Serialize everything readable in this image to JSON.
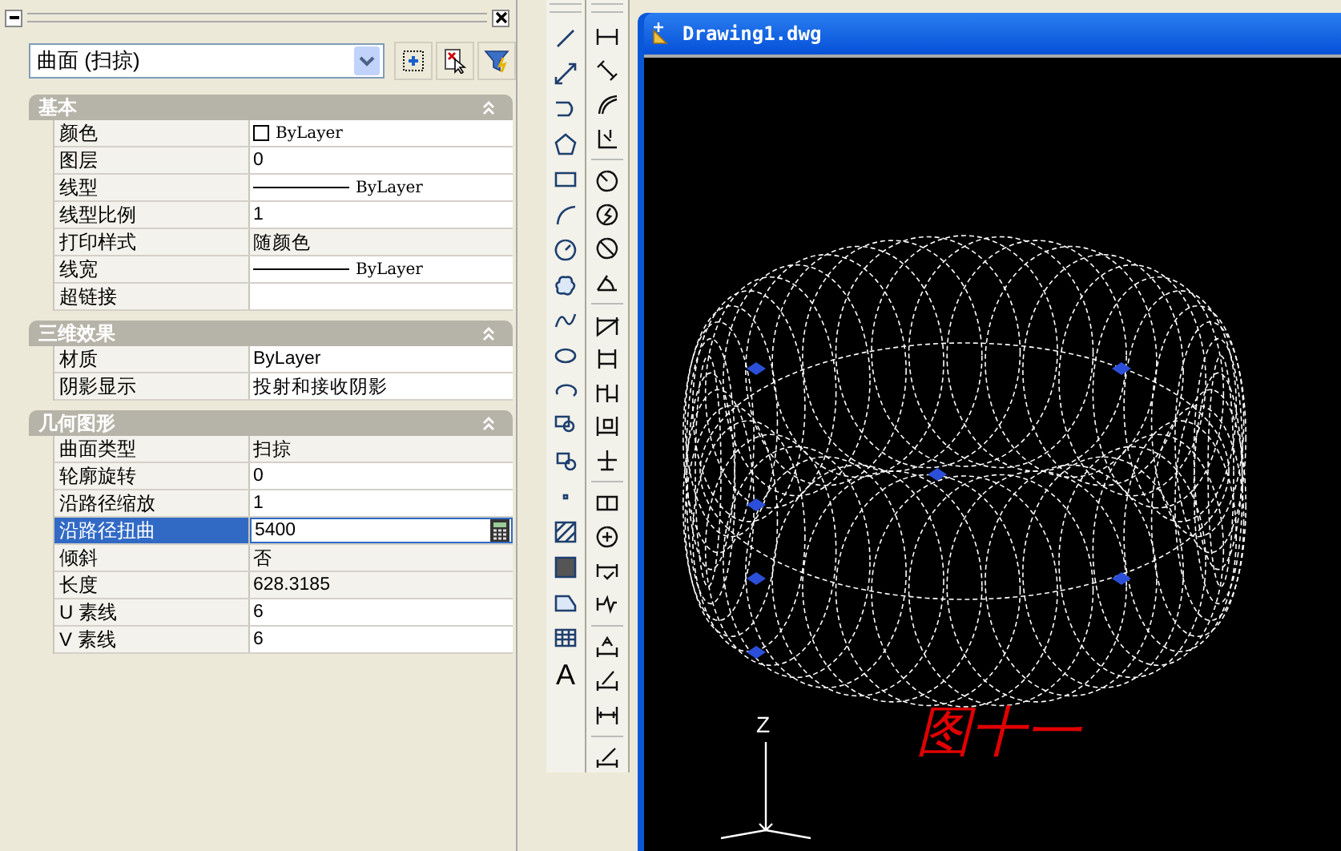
{
  "panel": {
    "selection": "曲面 (扫掠)",
    "sections": [
      {
        "title": "基本",
        "expanded": true,
        "rows": [
          {
            "label": "颜色",
            "value": "ByLayer",
            "kind": "color",
            "readonly": false,
            "selected": false
          },
          {
            "label": "图层",
            "value": "0",
            "kind": "plain",
            "readonly": false,
            "selected": false
          },
          {
            "label": "线型",
            "value": "ByLayer",
            "kind": "linetype",
            "readonly": false,
            "selected": false
          },
          {
            "label": "线型比例",
            "value": "1",
            "kind": "plain",
            "readonly": false,
            "selected": false
          },
          {
            "label": "打印样式",
            "value": "随颜色",
            "kind": "plain",
            "readonly": true,
            "selected": false
          },
          {
            "label": "线宽",
            "value": "ByLayer",
            "kind": "linetype",
            "readonly": false,
            "selected": false
          },
          {
            "label": "超链接",
            "value": "",
            "kind": "plain",
            "readonly": false,
            "selected": false
          }
        ]
      },
      {
        "title": "三维效果",
        "expanded": true,
        "rows": [
          {
            "label": "材质",
            "value": "ByLayer",
            "kind": "plain",
            "readonly": false,
            "selected": false
          },
          {
            "label": "阴影显示",
            "value": "投射和接收阴影",
            "kind": "plain",
            "readonly": false,
            "selected": false
          }
        ]
      },
      {
        "title": "几何图形",
        "expanded": true,
        "rows": [
          {
            "label": "曲面类型",
            "value": "扫掠",
            "kind": "plain",
            "readonly": true,
            "selected": false
          },
          {
            "label": "轮廓旋转",
            "value": "0",
            "kind": "plain",
            "readonly": false,
            "selected": false
          },
          {
            "label": "沿路径缩放",
            "value": "1",
            "kind": "plain",
            "readonly": false,
            "selected": false
          },
          {
            "label": "沿路径扭曲",
            "value": "5400",
            "kind": "plain",
            "readonly": false,
            "selected": true
          },
          {
            "label": "倾斜",
            "value": "否",
            "kind": "plain",
            "readonly": true,
            "selected": false
          },
          {
            "label": "长度",
            "value": "628.3185",
            "kind": "plain",
            "readonly": true,
            "selected": false
          },
          {
            "label": "U 素线",
            "value": "6",
            "kind": "plain",
            "readonly": false,
            "selected": false
          },
          {
            "label": "V 素线",
            "value": "6",
            "kind": "plain",
            "readonly": false,
            "selected": false
          }
        ]
      }
    ]
  },
  "toolbar": {
    "text_tool": "A"
  },
  "drawing_window": {
    "title": "Drawing1.dwg",
    "caption": "图十一",
    "axis_label": "Z"
  }
}
